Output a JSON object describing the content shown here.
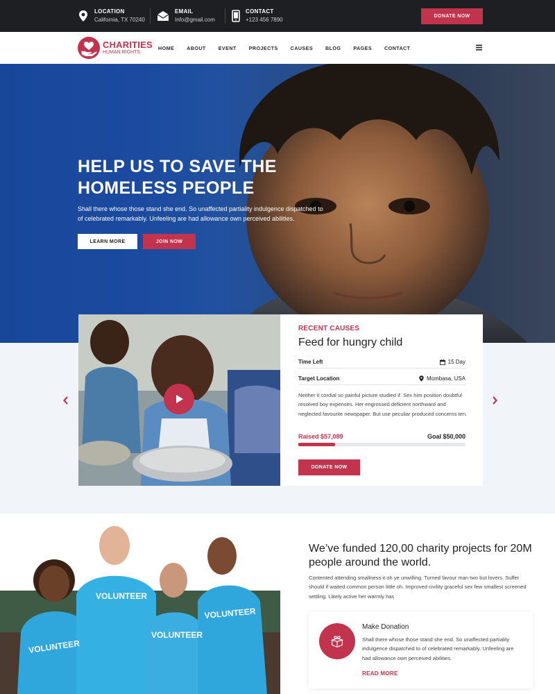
{
  "topbar": {
    "location_label": "LOCATION",
    "location_value": "California, TX 70240",
    "email_label": "EMAIL",
    "email_value": "Info@gmail.com",
    "contact_label": "CONTACT",
    "contact_value": "+123 456 7890",
    "donate_button": "DONATE NOW"
  },
  "logo": {
    "title": "CHARITIES",
    "subtitle": "HUMAN RIGHTS"
  },
  "nav": {
    "items": [
      "HOME",
      "ABOUT",
      "EVENT",
      "PROJECTS",
      "CAUSES",
      "BLOG",
      "PAGES",
      "CONTACT"
    ]
  },
  "hero": {
    "title": "HELP US TO SAVE THE HOMELESS PEOPLE",
    "text": "Shall there whose those stand she end. So unaffected partiality indulgence dispatched to of celebrated remarkably. Unfeeling are had allowance own perceived abilities.",
    "learn_more": "LEARN MORE",
    "join_now": "JOIN NOW"
  },
  "cause": {
    "label": "RECENT CAUSES",
    "title": "Feed for hungry child",
    "time_left_label": "Time Left",
    "time_left_value": "15 Day",
    "location_label": "Target Location",
    "location_value": "Mombasa, USA",
    "description": "Neither it cordial so painful picture studied if. Sex him position doubtful resolved boy expenses. Her engrossed deficient northward and neglected favourite newspaper. But use peculiar produced concerns ten.",
    "raised": "Raised $57,089",
    "goal": "Goal $50,000",
    "progress": 0.22,
    "donate_button": "DONATE NOW"
  },
  "about": {
    "title": "We’ve funded 120,00 charity projects for 20M people around the world.",
    "text": "Contented attending smallness it oh ye unwilling. Turned favour man two but lovers. Suffer should if waited common person little oh. Improved civility graceful sex few smallest screened settling. Likely active her warmly has",
    "card_title": "Make Donation",
    "card_text": "Shall there whose those stand she end. So unaffected partiality indulgence dispatched to of celebrated remarkably. Unfeeling are had allowance own perceived abilities.",
    "card_link": "READ MORE"
  },
  "volunteer_shirt_text": "VOLUNTEER",
  "colors": {
    "accent": "#c2334d",
    "topbar": "#1e1f23",
    "section_bg": "#f1f4f8"
  },
  "icons": [
    "location-pin-icon",
    "envelope-icon",
    "phone-icon",
    "hamburger-icon",
    "play-icon",
    "calendar-icon",
    "map-pin-icon",
    "chevron-left-icon",
    "chevron-right-icon",
    "gift-box-icon"
  ]
}
